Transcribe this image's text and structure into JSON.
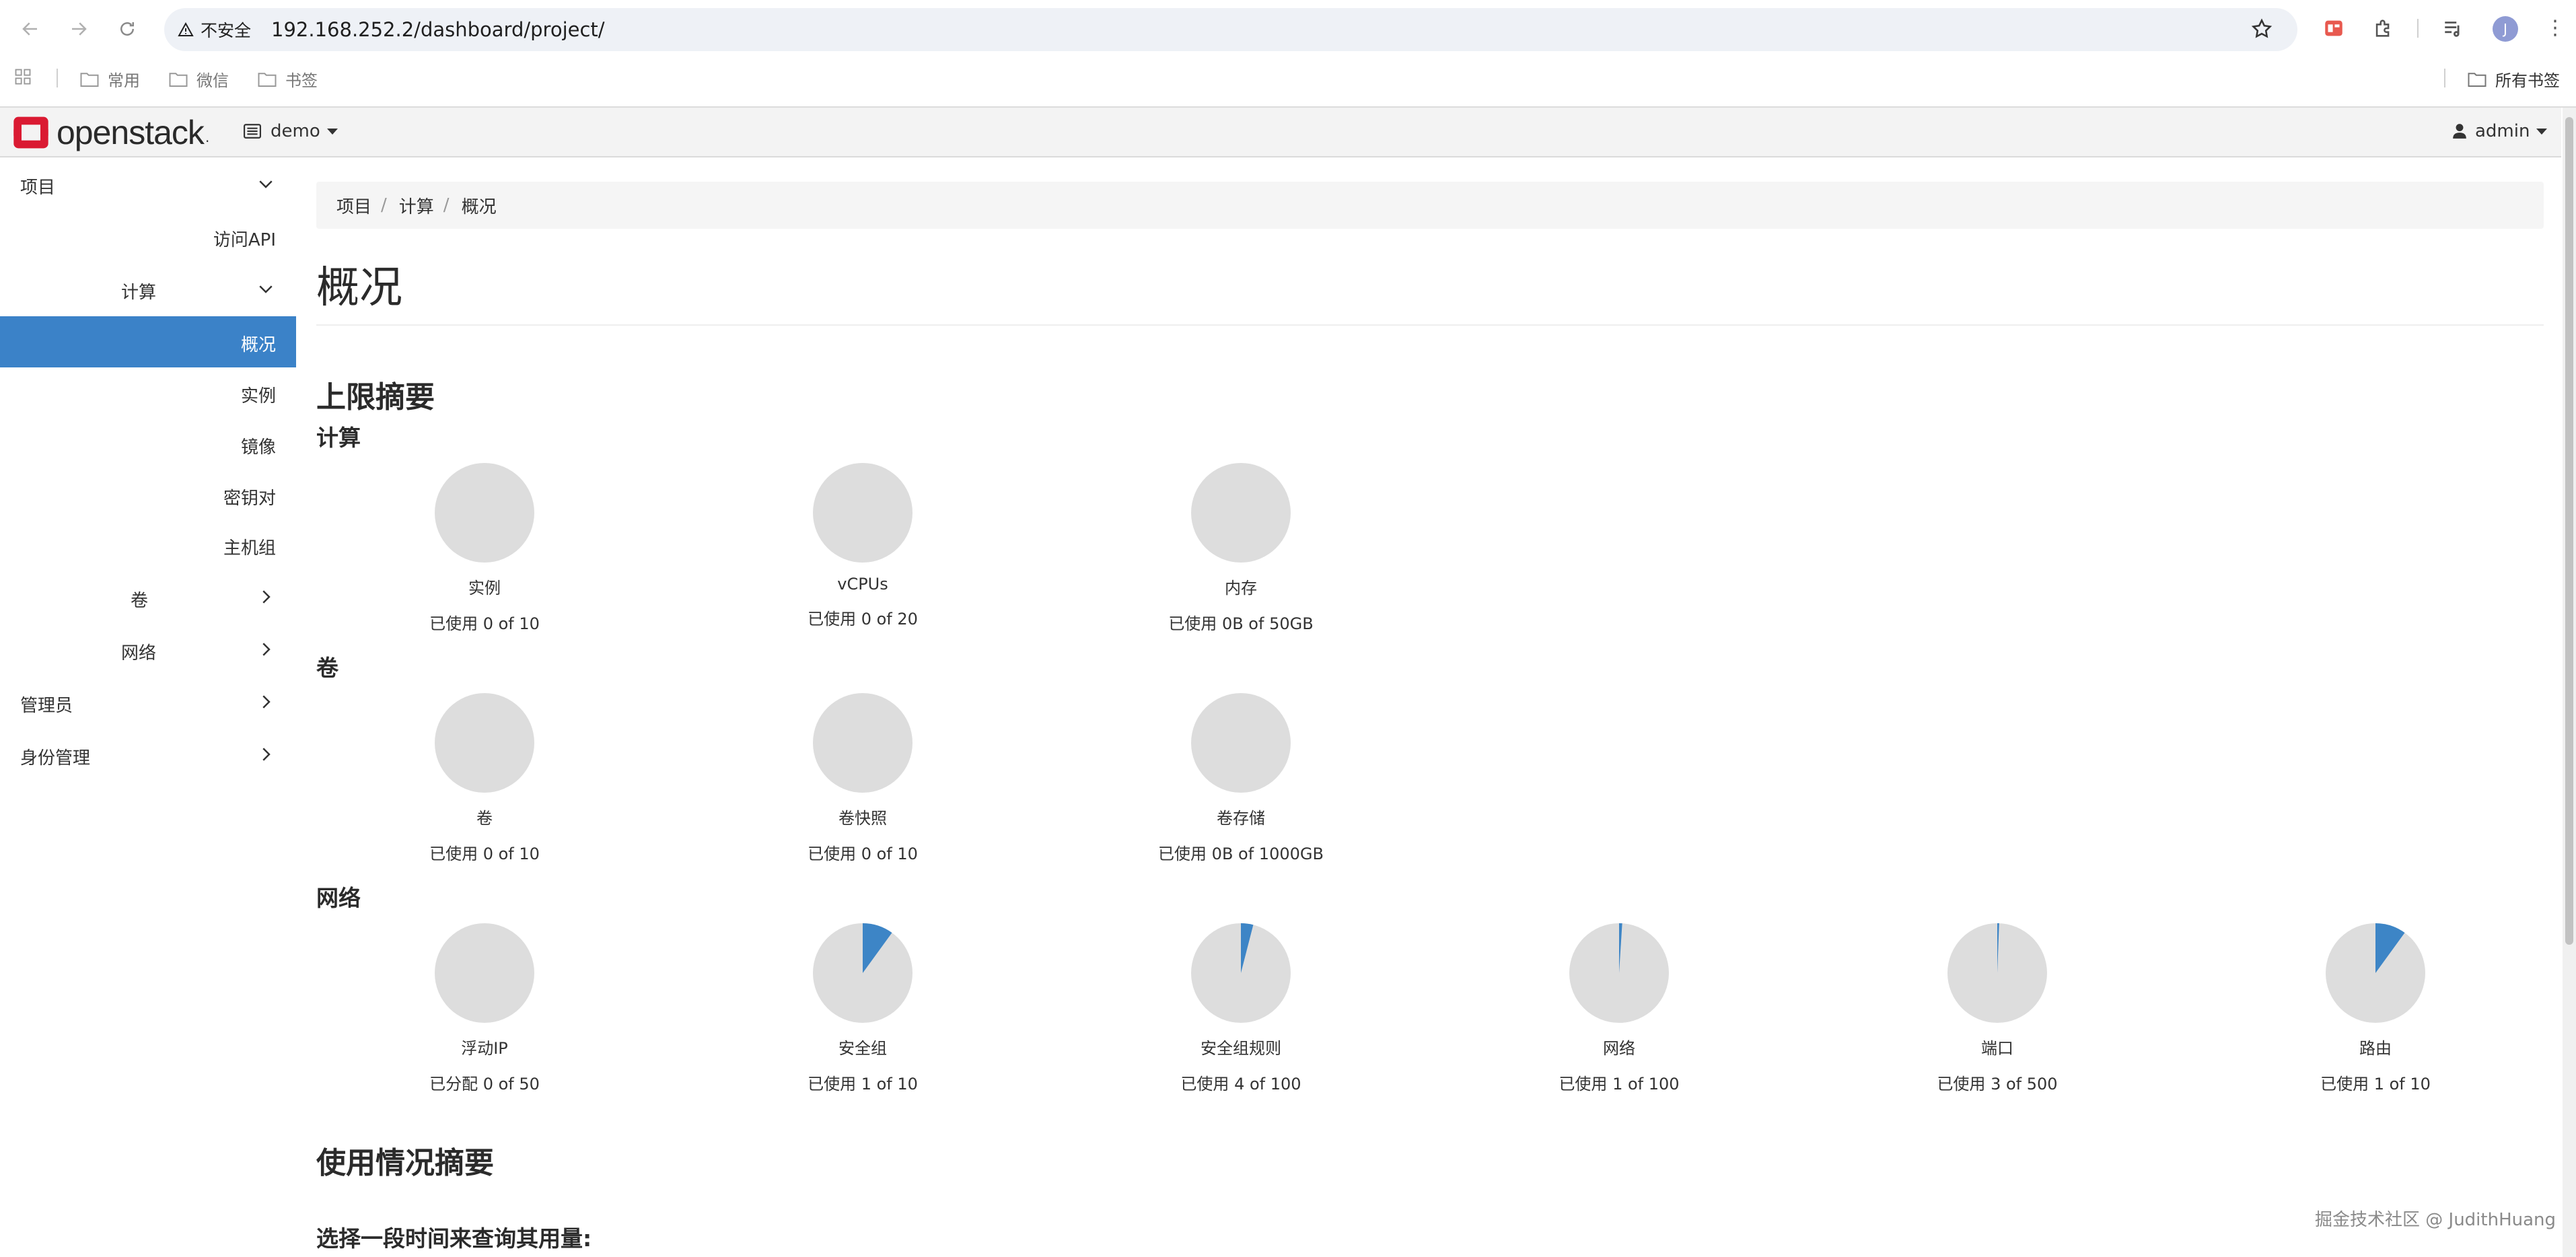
{
  "browser": {
    "insecure_label": "不安全",
    "url": "192.168.252.2/dashboard/project/",
    "bookmarks": [
      "常用",
      "微信",
      "书签"
    ],
    "all_bookmarks": "所有书签",
    "profile_initial": "J"
  },
  "navbar": {
    "logo_text": "openstack",
    "logo_dot": ".",
    "project": "demo",
    "user": "admin"
  },
  "sidebar": {
    "project": "项目",
    "api_access": "访问API",
    "compute": "计算",
    "overview": "概况",
    "instances": "实例",
    "images": "镜像",
    "keypairs": "密钥对",
    "server_groups": "主机组",
    "volumes": "卷",
    "network": "网络",
    "admin": "管理员",
    "identity": "身份管理"
  },
  "breadcrumb": [
    "项目",
    "计算",
    "概况"
  ],
  "page_title": "概况",
  "limit_summary": "上限摘要",
  "groups": {
    "compute": "计算",
    "volume": "卷",
    "network": "网络"
  },
  "quotas": {
    "compute": [
      {
        "name": "实例",
        "used_text": "已使用 0 of 10",
        "used": 0,
        "limit": 10
      },
      {
        "name": "vCPUs",
        "used_text": "已使用 0 of 20",
        "used": 0,
        "limit": 20
      },
      {
        "name": "内存",
        "used_text": "已使用 0B of 50GB",
        "used": 0,
        "limit": 50
      }
    ],
    "volume": [
      {
        "name": "卷",
        "used_text": "已使用 0 of 10",
        "used": 0,
        "limit": 10
      },
      {
        "name": "卷快照",
        "used_text": "已使用 0 of 10",
        "used": 0,
        "limit": 10
      },
      {
        "name": "卷存储",
        "used_text": "已使用 0B of 1000GB",
        "used": 0,
        "limit": 1000
      }
    ],
    "network": [
      {
        "name": "浮动IP",
        "used_text": "已分配 0 of 50",
        "used": 0,
        "limit": 50
      },
      {
        "name": "安全组",
        "used_text": "已使用 1 of 10",
        "used": 1,
        "limit": 10
      },
      {
        "name": "安全组规则",
        "used_text": "已使用 4 of 100",
        "used": 4,
        "limit": 100
      },
      {
        "name": "网络",
        "used_text": "已使用 1 of 100",
        "used": 1,
        "limit": 100
      },
      {
        "name": "端口",
        "used_text": "已使用 3 of 500",
        "used": 3,
        "limit": 500
      },
      {
        "name": "路由",
        "used_text": "已使用 1 of 10",
        "used": 1,
        "limit": 10
      }
    ]
  },
  "colors": {
    "pie_empty": "#dddddd",
    "pie_used": "#3d85c6",
    "active_nav": "#3b82c8"
  },
  "usage_summary": "使用情况摘要",
  "query_prompt": "选择一段时间来查询其用量:",
  "watermark": "掘金技术社区 @ JudithHuang"
}
